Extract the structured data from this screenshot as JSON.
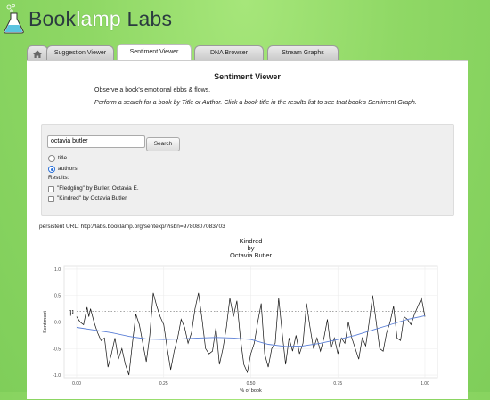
{
  "app": {
    "logo": {
      "part1": "Book",
      "part2": "lamp",
      "part3": " Labs"
    }
  },
  "tabs": [
    {
      "label": "",
      "icon": "home-icon"
    },
    {
      "label": "Suggestion Viewer"
    },
    {
      "label": "Sentiment Viewer",
      "active": true
    },
    {
      "label": "DNA Browser"
    },
    {
      "label": "Stream Graphs"
    }
  ],
  "page": {
    "title": "Sentiment Viewer",
    "intro": "Observe a book's emotional ebbs & flows.",
    "instructions": "Perform a search for a book by Title or Author. Click a book title in the results list to see that book's Sentiment Graph."
  },
  "search": {
    "value": "octavia butler",
    "button": "Search",
    "options": [
      {
        "label": "title",
        "selected": false
      },
      {
        "label": "authors",
        "selected": true
      }
    ],
    "results_label": "Results:",
    "results": [
      {
        "label": "\"Fledgling\" by Butler, Octavia E."
      },
      {
        "label": "\"Kindred\" by Octavia Butler"
      }
    ]
  },
  "persistent_url": "persistent URL: http://labs.booklamp.org/sentexp/?isbn=9780807083703",
  "colors": {
    "accent": "#2a6fd6",
    "smooth": "#5b7fd6",
    "background": "#8fd865"
  },
  "chart_data": {
    "type": "line",
    "title": [
      "Kindred",
      "by",
      "Octavia Butler"
    ],
    "xlabel": "% of book",
    "ylabel": "Sentiment",
    "xlim": [
      0,
      1
    ],
    "ylim": [
      -1.05,
      1.05
    ],
    "xticks": [
      "0.00",
      "0.25",
      "0.50",
      "0.75",
      "1.00"
    ],
    "yticks": [
      "1.0",
      "0.5",
      "0.0",
      "-0.5",
      "-1.0"
    ],
    "mean_label": "μ",
    "mean": 0.2,
    "grid": true,
    "series": [
      {
        "style": "raw",
        "x": [
          0.0,
          0.01,
          0.02,
          0.03,
          0.035,
          0.04,
          0.05,
          0.06,
          0.07,
          0.08,
          0.09,
          0.1,
          0.11,
          0.12,
          0.13,
          0.14,
          0.15,
          0.16,
          0.17,
          0.175,
          0.18,
          0.19,
          0.2,
          0.21,
          0.22,
          0.23,
          0.24,
          0.25,
          0.26,
          0.27,
          0.28,
          0.29,
          0.3,
          0.31,
          0.32,
          0.33,
          0.34,
          0.35,
          0.36,
          0.37,
          0.38,
          0.39,
          0.4,
          0.41,
          0.42,
          0.43,
          0.44,
          0.45,
          0.46,
          0.47,
          0.48,
          0.49,
          0.5,
          0.51,
          0.52,
          0.53,
          0.54,
          0.55,
          0.56,
          0.57,
          0.58,
          0.59,
          0.6,
          0.61,
          0.62,
          0.63,
          0.64,
          0.65,
          0.66,
          0.67,
          0.68,
          0.69,
          0.7,
          0.71,
          0.72,
          0.73,
          0.74,
          0.75,
          0.76,
          0.77,
          0.78,
          0.79,
          0.8,
          0.81,
          0.82,
          0.83,
          0.84,
          0.85,
          0.86,
          0.87,
          0.88,
          0.89,
          0.9,
          0.91,
          0.92,
          0.93,
          0.94,
          0.95,
          0.96,
          0.97,
          0.98,
          0.99,
          1.0
        ],
        "y": [
          0.1,
          0.0,
          -0.05,
          0.28,
          0.1,
          0.25,
          0.0,
          -0.2,
          -0.35,
          -0.3,
          -0.85,
          -0.6,
          -0.3,
          -0.7,
          -0.5,
          -0.8,
          -1.0,
          -0.4,
          0.15,
          0.05,
          -0.05,
          -0.4,
          -0.75,
          -0.25,
          0.55,
          0.3,
          0.1,
          -0.05,
          -0.5,
          -0.9,
          -0.55,
          -0.3,
          0.05,
          -0.1,
          -0.4,
          -0.2,
          0.25,
          0.55,
          0.05,
          -0.5,
          -0.6,
          -0.55,
          -0.1,
          -0.8,
          -0.5,
          -0.1,
          0.45,
          0.1,
          0.4,
          -0.3,
          -0.8,
          -0.95,
          -0.6,
          -0.4,
          0.0,
          0.35,
          -0.6,
          -0.85,
          -0.5,
          -0.4,
          0.45,
          -0.2,
          -0.8,
          -0.3,
          -0.55,
          -0.25,
          -0.6,
          -0.4,
          0.35,
          -0.1,
          -0.5,
          -0.3,
          -0.55,
          -0.3,
          0.05,
          -0.5,
          -0.3,
          -0.6,
          -0.3,
          -0.4,
          0.0,
          -0.3,
          -0.5,
          -0.7,
          -0.3,
          -0.45,
          0.0,
          0.5,
          0.0,
          -0.5,
          -0.55,
          -0.2,
          0.0,
          0.3,
          -0.3,
          -0.35,
          0.1,
          0.05,
          -0.05,
          0.15,
          0.3,
          0.45,
          0.1
        ]
      },
      {
        "style": "smooth",
        "x": [
          0.0,
          0.05,
          0.1,
          0.15,
          0.2,
          0.25,
          0.3,
          0.35,
          0.4,
          0.45,
          0.5,
          0.55,
          0.6,
          0.65,
          0.7,
          0.75,
          0.8,
          0.85,
          0.9,
          0.95,
          1.0
        ],
        "y": [
          -0.1,
          -0.15,
          -0.2,
          -0.27,
          -0.32,
          -0.33,
          -0.32,
          -0.3,
          -0.29,
          -0.3,
          -0.33,
          -0.42,
          -0.46,
          -0.45,
          -0.4,
          -0.33,
          -0.25,
          -0.15,
          -0.05,
          0.05,
          0.12
        ]
      }
    ]
  }
}
